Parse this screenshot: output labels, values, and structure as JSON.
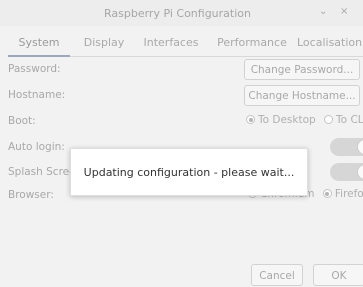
{
  "window": {
    "title": "Raspberry Pi Configuration",
    "minimize_glyph": "⌄",
    "close_glyph": "×"
  },
  "tabs": [
    "System",
    "Display",
    "Interfaces",
    "Performance",
    "Localisation"
  ],
  "active_tab": "System",
  "rows": {
    "password": {
      "label": "Password:",
      "button": "Change Password..."
    },
    "hostname": {
      "label": "Hostname:",
      "button": "Change Hostname..."
    },
    "boot": {
      "label": "Boot:",
      "options": [
        "To Desktop",
        "To CLI"
      ],
      "selected": "To Desktop"
    },
    "auto_login": {
      "label": "Auto login:",
      "enabled": true
    },
    "splash_screen": {
      "label": "Splash Screen:",
      "enabled": true
    },
    "browser": {
      "label": "Browser:",
      "options": [
        "Chromium",
        "Firefox"
      ],
      "selected": "Firefox"
    }
  },
  "footer": {
    "cancel": "Cancel",
    "ok": "OK"
  },
  "dialog": {
    "message": "Updating configuration - please wait..."
  }
}
